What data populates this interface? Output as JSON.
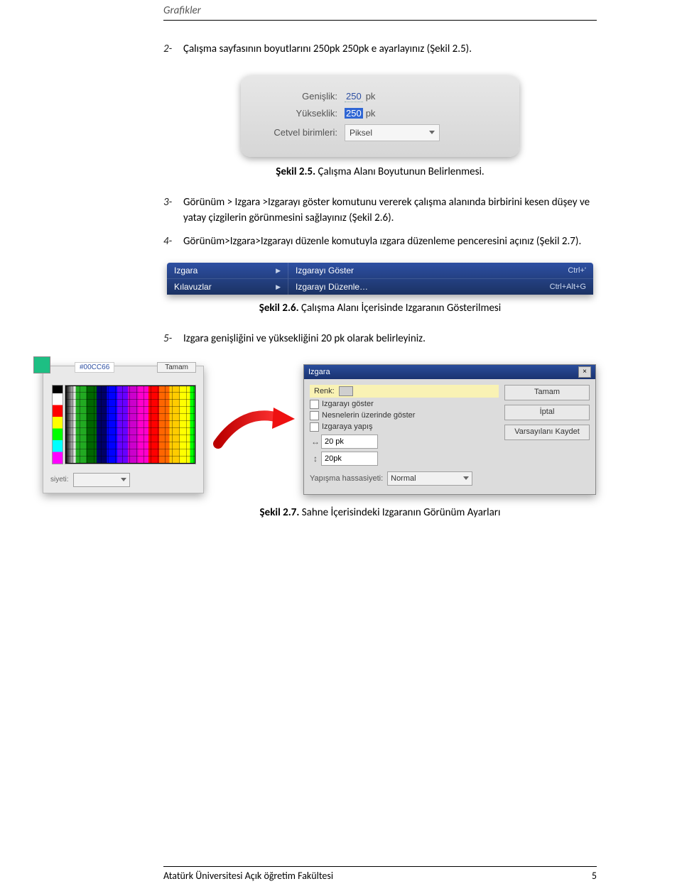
{
  "header": {
    "title": "Grafikler"
  },
  "items": {
    "i2": {
      "num": "2-",
      "text": "Çalışma sayfasının boyutlarını 250pk 250pk e ayarlayınız (Şekil 2.5)."
    },
    "i3": {
      "num": "3-",
      "text": "Görünüm > Izgara >Izgarayı göster komutunu vererek çalışma alanında birbirini kesen düşey ve yatay çizgilerin görünmesini sağlayınız (Şekil 2.6)."
    },
    "i4": {
      "num": "4-",
      "text": "Görünüm>Izgara>Izgarayı düzenle komutuyla ızgara düzenleme penceresini açınız (Şekil 2.7)."
    },
    "i5": {
      "num": "5-",
      "text": "Izgara genişliğini ve yüksekliğini 20 pk olarak belirleyiniz."
    }
  },
  "panel25": {
    "width_label": "Genişlik:",
    "width_value": "250",
    "height_label": "Yükseklik:",
    "height_value": "250",
    "unit_suffix": "pk",
    "ruler_label": "Cetvel birimleri:",
    "ruler_value": "Piksel"
  },
  "captions": {
    "c25b": "Şekil 2.5.",
    "c25t": " Çalışma Alanı Boyutunun Belirlenmesi.",
    "c26b": "Şekil 2.6.",
    "c26t": " Çalışma Alanı İçerisinde Izgaranın Gösterilmesi",
    "c27b": "Şekil 2.7.",
    "c27t": " Sahne İçerisindeki Izgaranın Görünüm Ayarları"
  },
  "menubar": {
    "left1": "Izgara",
    "left2": "Kılavuzlar",
    "right1_label": "Izgarayı Göster",
    "right1_kbd": "Ctrl+'",
    "right2_label": "Izgarayı Düzenle…",
    "right2_kbd": "Ctrl+Alt+G"
  },
  "palette": {
    "btn_ok": "Tamam",
    "hex": "#00CC66",
    "bottom_label": "siyeti:"
  },
  "dialog": {
    "title": "Izgara",
    "renk_label": "Renk:",
    "ck1": "Izgarayı göster",
    "ck2": "Nesnelerin üzerinde göster",
    "ck3": "Izgaraya yapış",
    "hval": "20 pk",
    "vval": "20pk",
    "snap_label": "Yapışma hassasiyeti:",
    "snap_value": "Normal",
    "btn_ok": "Tamam",
    "btn_cancel": "İptal",
    "btn_savedef": "Varsayılanı Kaydet"
  },
  "footer": {
    "left": "Atatürk Üniversitesi Açık öğretim Fakültesi",
    "right": "5"
  }
}
